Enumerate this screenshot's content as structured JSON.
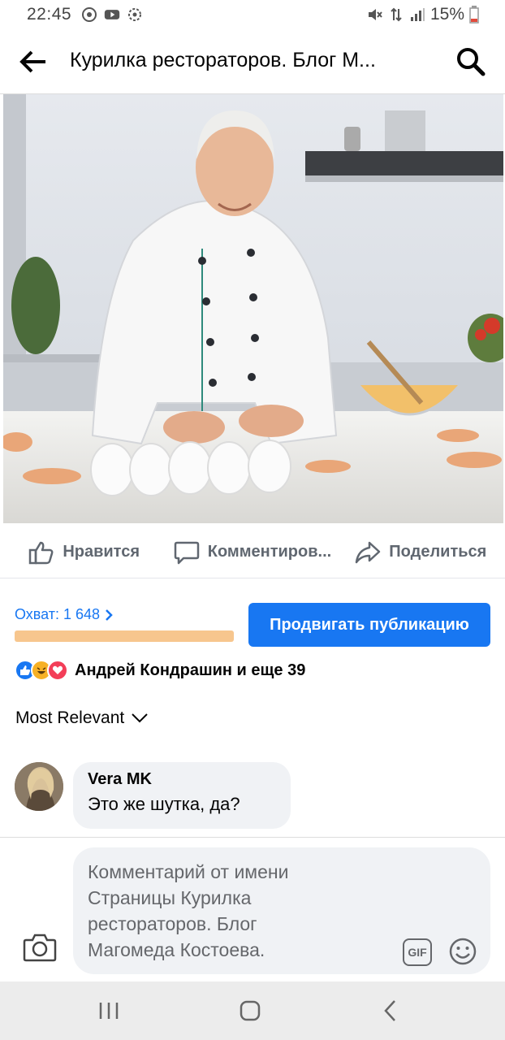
{
  "status_bar": {
    "time": "22:45",
    "battery": "15%",
    "icons": [
      "whatsapp-icon",
      "youtube-icon",
      "settings-flower-icon",
      "mute-icon",
      "data-arrows-icon",
      "signal-icon",
      "battery-icon"
    ]
  },
  "header": {
    "title": "Курилка рестораторов. Блог М...",
    "icons": [
      "back-arrow-icon",
      "search-icon"
    ]
  },
  "post": {
    "image_icon": "photo-chef-kneading-dough"
  },
  "actions": {
    "like": "Нравится",
    "comment": "Комментиров...",
    "share": "Поделиться"
  },
  "reach": {
    "label": "Охват: 1 648",
    "promote_button": "Продвигать публикацию"
  },
  "reactions": {
    "text": "Андрей Кондрашин и еще 39",
    "types": [
      "like",
      "haha",
      "love"
    ]
  },
  "sort": {
    "label": "Most Relevant"
  },
  "comments": [
    {
      "author": "Vera MK",
      "text": "Это же шутка, да?"
    }
  ],
  "composer": {
    "placeholder_lines": [
      "Комментарий от имени",
      "Страницы Курилка",
      "рестораторов. Блог",
      "Магомеда Костоева."
    ],
    "gif_label": "GIF"
  },
  "colors": {
    "accent": "#1877f2",
    "reach_bar": "#f7c68e",
    "bubble_bg": "#f0f2f5",
    "muted": "#606770"
  }
}
